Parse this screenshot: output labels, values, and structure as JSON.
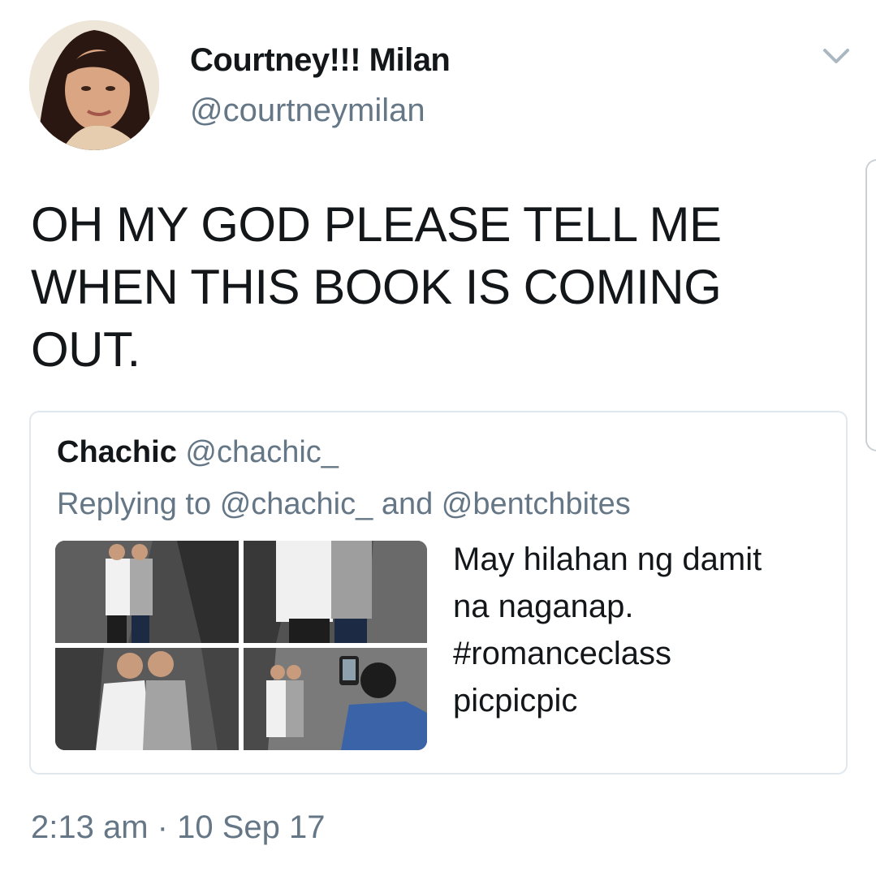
{
  "author": {
    "display_name": "Courtney!!! Milan",
    "handle": "@courtneymilan"
  },
  "tweet": {
    "line1": "OH MY GOD PLEASE TELL ME",
    "line2": "WHEN THIS BOOK IS COMING",
    "line3": "OUT."
  },
  "quoted_tweet": {
    "display_name": "Chachic",
    "handle": "@chachic_",
    "replying_prefix": "Replying to",
    "reply_to_1": "@chachic_",
    "reply_joiner": "and",
    "reply_to_2": "@bentchbites",
    "text_line1": "May hilahan ng damit",
    "text_line2": "na naganap.",
    "text_line3": "#romanceclass",
    "text_line4": "picpicpic"
  },
  "timestamp": {
    "time": "2:13 am",
    "separator": "·",
    "date": "10 Sep 17"
  },
  "icons": {
    "menu": "chevron-down-icon"
  },
  "colors": {
    "text_primary": "#14171a",
    "text_secondary": "#657786",
    "border": "#e1e8ed"
  }
}
